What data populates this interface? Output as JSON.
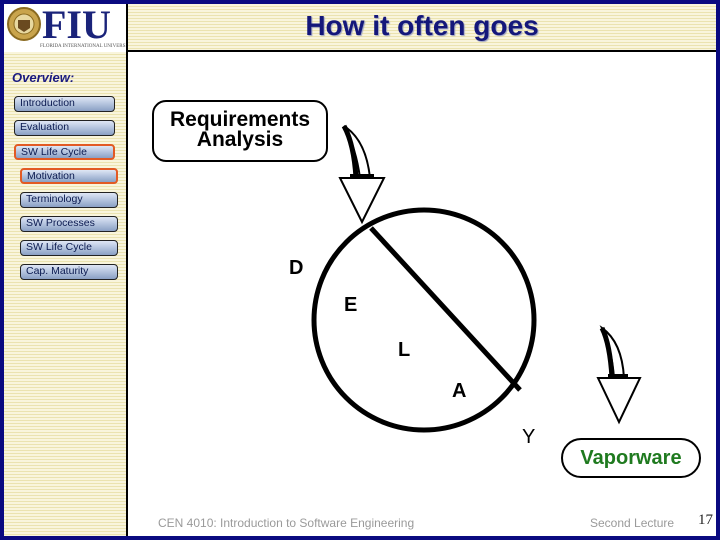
{
  "header": {
    "logo_text": "FIU",
    "logo_subtitle": "FLORIDA INTERNATIONAL UNIVERSITY",
    "title": "How it often goes"
  },
  "sidebar": {
    "heading": "Overview:",
    "items": [
      {
        "label": "Introduction",
        "active": false
      },
      {
        "label": "Evaluation",
        "active": false
      },
      {
        "label": "SW Life Cycle",
        "active": true
      },
      {
        "label": "Motivation",
        "active": true
      },
      {
        "label": "Terminology",
        "active": false
      },
      {
        "label": "SW Processes",
        "active": false
      },
      {
        "label": "SW Life Cycle",
        "active": false
      },
      {
        "label": "Cap. Maturity",
        "active": false
      }
    ]
  },
  "diagram": {
    "start_label": "Requirements Analysis",
    "start_line1": "Requirements",
    "start_line2": "Analysis",
    "cycle_letters": [
      "D",
      "E",
      "L",
      "A",
      "Y"
    ],
    "end_label": "Vaporware"
  },
  "colors": {
    "frame": "#0a0a80",
    "title": "#14177a",
    "active_border": "#e25a24",
    "end_label": "#1f7a1f"
  },
  "footer": {
    "course": "CEN 4010: Introduction to Software Engineering",
    "lecture": "Second Lecture",
    "page": "17"
  }
}
